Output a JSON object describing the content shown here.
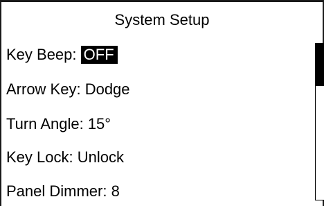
{
  "screen": {
    "title": "System Setup"
  },
  "menu": {
    "items": [
      {
        "label": "Key Beep: ",
        "value": "OFF",
        "selected": true
      },
      {
        "label": "Arrow Key: ",
        "value": "Dodge",
        "selected": false
      },
      {
        "label": "Turn Angle: ",
        "value": "15°",
        "selected": false
      },
      {
        "label": "Key Lock: ",
        "value": "Unlock",
        "selected": false
      },
      {
        "label": "Panel Dimmer: ",
        "value": "8",
        "selected": false
      }
    ]
  },
  "scrollbar": {
    "position_fraction": 0.0,
    "visible_fraction": 0.27
  },
  "colors": {
    "highlight_bg": "#000000",
    "highlight_fg": "#ffffff",
    "background": "#ffffff",
    "text": "#000000"
  }
}
